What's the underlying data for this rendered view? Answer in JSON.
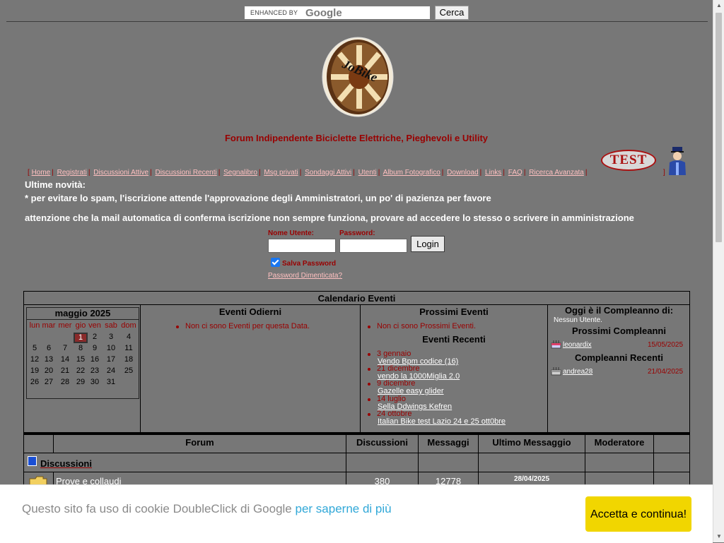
{
  "search": {
    "brand_prefix": "ENHANCED BY",
    "brand_word": "Google",
    "value": "",
    "button_label": "Cerca"
  },
  "logo": {
    "text": "JoBike"
  },
  "tagline": "Forum Indipendente Biciclette Elettriche, Pieghevoli e Utility",
  "nav": {
    "open": "[",
    "close": "]",
    "sep": "|",
    "items": [
      "Home",
      "Registrati",
      "Discussioni Attive",
      "Discussioni Recenti",
      "Segnalibro",
      "Msg privati",
      "Sondaggi Attivi",
      "Utenti",
      "Album Fotografico",
      "Download",
      "Links",
      "FAQ",
      "Ricerca Avanzata"
    ]
  },
  "test_badge": "TEST",
  "notices": {
    "title": "Ultime novità:",
    "line1": "* per evitare lo spam, l'iscrizione attende l'approvazione degli Amministratori, un po' di pazienza per favore",
    "line2": "attenzione che la mail automatica di conferma iscrizione non sempre funziona, provare ad accedere lo stesso o scrivere in amministrazione"
  },
  "login": {
    "username_label": "Nome Utente:",
    "password_label": "Password:",
    "username_value": "",
    "password_value": "",
    "button_label": "Login",
    "remember_label": "Salva Password",
    "remember_checked": true,
    "forgot_label": "Password Dimenticata?"
  },
  "calendar": {
    "title": "Calendario Eventi",
    "month_label": "maggio 2025",
    "weekdays": [
      "lun",
      "mar",
      "mer",
      "gio",
      "ven",
      "sab",
      "dom"
    ],
    "weeks": [
      [
        "",
        "",
        "",
        "1",
        "2",
        "3",
        "4"
      ],
      [
        "5",
        "6",
        "7",
        "8",
        "9",
        "10",
        "11"
      ],
      [
        "12",
        "13",
        "14",
        "15",
        "16",
        "17",
        "18"
      ],
      [
        "19",
        "20",
        "21",
        "22",
        "23",
        "24",
        "25"
      ],
      [
        "26",
        "27",
        "28",
        "29",
        "30",
        "31",
        ""
      ]
    ],
    "today": "1",
    "today_events_title": "Eventi Odierni",
    "today_events_empty": "Non ci sono Eventi per questa Data.",
    "next_events_title": "Prossimi Eventi",
    "next_events_empty": "Non ci sono Prossimi Eventi.",
    "recent_events_title": "Eventi Recenti",
    "recent_events": [
      {
        "date": "3 gennaio",
        "title": "Vendo Bpm codice (16)"
      },
      {
        "date": "21 dicembre",
        "title": "vendo la 1000Miglia 2.0"
      },
      {
        "date": "9 dicembre",
        "title": "Gazelle easy glider"
      },
      {
        "date": "14 luglio",
        "title": "Sella Ddwings Kefren"
      },
      {
        "date": "24 ottobre",
        "title": "Italian Bike test Lazio 24 e 25 ott0bre"
      }
    ],
    "birthday_today_title": "Oggi è il Compleanno di:",
    "birthday_today_empty": "Nessun Utente.",
    "next_birthdays_title": "Prossimi Compleanni",
    "next_birthdays": [
      {
        "name": "leonardix",
        "date": "15/05/2025"
      }
    ],
    "recent_birthdays_title": "Compleanni Recenti",
    "recent_birthdays": [
      {
        "name": "andrea28",
        "date": "21/04/2025"
      }
    ]
  },
  "forum_table": {
    "headers": {
      "forum": "Forum",
      "topics": "Discussioni",
      "posts": "Messaggi",
      "last_post": "Ultimo Messaggio",
      "moderator": "Moderatore"
    },
    "category": "Discussioni",
    "rows": [
      {
        "name": "Prove e collaudi",
        "topics": "380",
        "posts": "12778",
        "last_date": "28/04/2025"
      }
    ]
  },
  "cookie": {
    "text": "Questo sito fa uso di cookie DoubleClick di Google",
    "link": "per saperne di più",
    "button": "Accetta e continua!"
  },
  "colors": {
    "background": "#777777",
    "accent_red": "#990000",
    "link_pink": "#ffc0c0",
    "cookie_button": "#f1d600"
  }
}
